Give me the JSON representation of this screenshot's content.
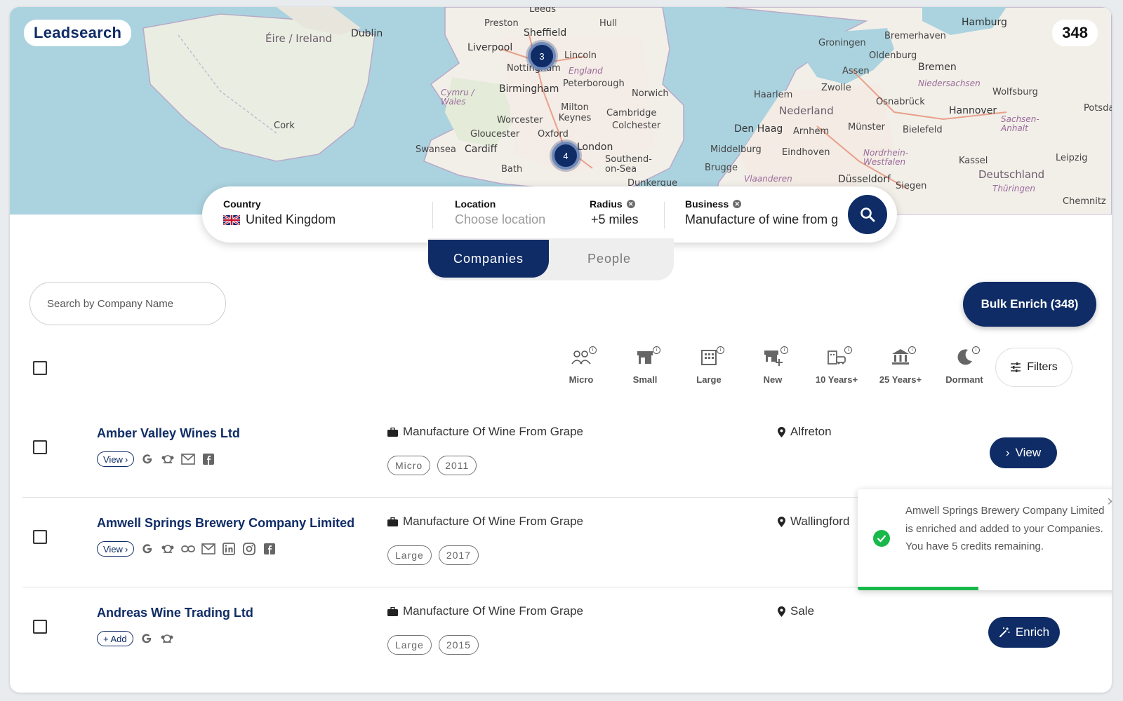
{
  "app": {
    "brand": "Leadsearch",
    "result_count": "348"
  },
  "map": {
    "labels": [
      "Éire / Ireland",
      "Dublin",
      "Cork",
      "Liverpool",
      "Preston",
      "Sheffield",
      "Hull",
      "Lincoln",
      "England",
      "Nottingham",
      "Birmingham",
      "Peterborough",
      "Norwich",
      "Cymru / Wales",
      "Milton Keynes",
      "Cambridge",
      "Colchester",
      "Worcester",
      "Gloucester",
      "Oxford",
      "Swansea",
      "Cardiff",
      "London",
      "Southend-on-Sea",
      "Bath",
      "Leeds",
      "Groningen",
      "Bremerhaven",
      "Hamburg",
      "Oldenburg",
      "Bremen",
      "Assen",
      "Zwolle",
      "Niedersachsen",
      "Haarlem",
      "Nederland",
      "Osnabrück",
      "Hannover",
      "Wolfsburg",
      "Den Haag",
      "Arnhem",
      "Münster",
      "Bielefeld",
      "Sachsen-Anhalt",
      "Middelburg",
      "Eindhoven",
      "Brugge",
      "Vlaanderen",
      "Nordrhein-Westfalen",
      "Düsseldorf",
      "Kassel",
      "Deutschland",
      "Leipzig",
      "Siegen",
      "Thüringen",
      "Chemnitz",
      "Potsdam",
      "Dunkerque"
    ],
    "clusters": [
      "3",
      "4"
    ]
  },
  "search": {
    "country_label": "Country",
    "country_value": "United Kingdom",
    "location_label": "Location",
    "location_placeholder": "Choose location",
    "radius_label": "Radius",
    "radius_value": "+5 miles",
    "business_label": "Business",
    "business_value": "Manufacture of wine from g"
  },
  "tabs": [
    {
      "label": "Companies",
      "active": true
    },
    {
      "label": "People",
      "active": false
    }
  ],
  "toolbar": {
    "company_search_placeholder": "Search by Company Name",
    "bulk_enrich_label": "Bulk Enrich (348)",
    "filters_label": "Filters"
  },
  "size_filters": [
    {
      "label": "Micro",
      "icon": "people-icon"
    },
    {
      "label": "Small",
      "icon": "shop-icon"
    },
    {
      "label": "Large",
      "icon": "building-icon"
    },
    {
      "label": "New",
      "icon": "new-shop-icon"
    },
    {
      "label": "10 Years+",
      "icon": "building-car-icon"
    },
    {
      "label": "25 Years+",
      "icon": "bank-icon"
    },
    {
      "label": "Dormant",
      "icon": "moon-icon"
    }
  ],
  "companies": [
    {
      "name": "Amber Valley Wines Ltd",
      "link_label": "View",
      "industry": "Manufacture Of Wine From Grape",
      "tags": [
        "Micro",
        "2011"
      ],
      "location": "Alfreton",
      "action": "View",
      "icons": [
        "google-icon",
        "companies-house-icon",
        "email-icon",
        "facebook-icon"
      ]
    },
    {
      "name": "Amwell Springs Brewery Company Limited",
      "link_label": "View",
      "industry": "Manufacture Of Wine From Grape",
      "tags": [
        "Large",
        "2017"
      ],
      "location": "Wallingford",
      "action": "",
      "icons": [
        "google-icon",
        "companies-house-icon",
        "website-link-icon",
        "email-icon",
        "linkedin-icon",
        "instagram-icon",
        "facebook-icon"
      ]
    },
    {
      "name": "Andreas Wine Trading Ltd",
      "link_label": "+ Add",
      "industry": "Manufacture Of Wine From Grape",
      "tags": [
        "Large",
        "2015"
      ],
      "location": "Sale",
      "action": "Enrich",
      "icons": [
        "google-icon",
        "companies-house-icon"
      ]
    }
  ],
  "toast": {
    "message": "Amwell Springs Brewery Company Limited is enriched and added to your Companies. You have 5 credits remaining.",
    "progress": 0.45
  },
  "colors": {
    "primary": "#0f2c66",
    "success": "#19b84a",
    "map_water": "#aad3df",
    "map_land": "#f2efe9"
  }
}
